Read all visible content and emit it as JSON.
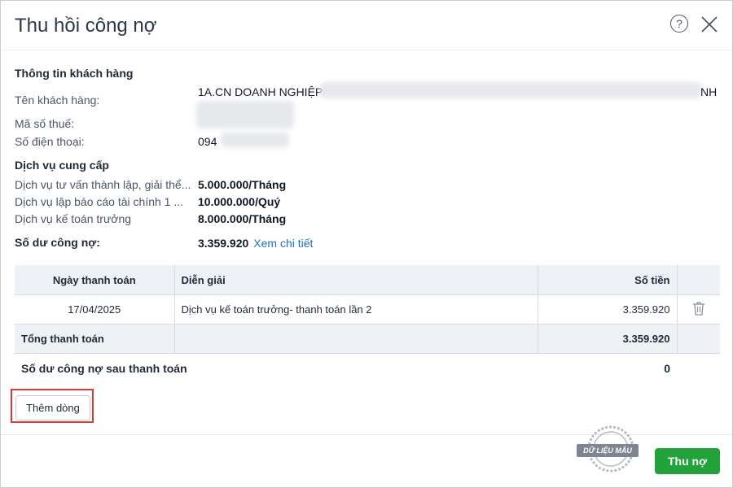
{
  "dialog": {
    "title": "Thu hồi công nợ",
    "help_icon": "?",
    "close_icon": "close-icon"
  },
  "customer": {
    "section_title": "Thông tin khách hàng",
    "name_label": "Tên khách hàng:",
    "name_value": "1A.CN DOANH NGHIỆP",
    "name_tail": "NH",
    "tax_label": "Mã số thuế:",
    "phone_label": "Số điện thoại:",
    "phone_value": "094"
  },
  "services": {
    "section_title": "Dịch vụ cung cấp",
    "items": [
      {
        "name": "Dịch vụ tư vấn thành lập, giải thể...",
        "price": "5.000.000/Tháng"
      },
      {
        "name": "Dịch vụ lập báo cáo tài chính 1 ...",
        "price": "10.000.000/Quý"
      },
      {
        "name": "Dịch vụ kế toán trưởng",
        "price": "8.000.000/Tháng"
      }
    ]
  },
  "balance": {
    "label": "Số dư công nợ:",
    "value": "3.359.920",
    "link": "Xem chi tiết"
  },
  "table": {
    "headers": {
      "date": "Ngày thanh toán",
      "desc": "Diễn giải",
      "amount": "Số tiền"
    },
    "rows": [
      {
        "date": "17/04/2025",
        "desc": "Dịch vụ kế toán trưởng- thanh toán lần 2",
        "amount": "3.359.920"
      }
    ],
    "total_label": "Tổng thanh toán",
    "total_amount": "3.359.920"
  },
  "after": {
    "label": "Số dư công nợ sau thanh toán",
    "value": "0"
  },
  "buttons": {
    "add_row": "Thêm dòng",
    "collect": "Thu nợ"
  },
  "stamp": {
    "text": "DỮ LIỆU MẪU"
  },
  "colors": {
    "primary_green": "#22a33a",
    "link_blue": "#1a73c9",
    "highlight_red": "#d93a3a",
    "table_header_bg": "#eef1f6"
  }
}
